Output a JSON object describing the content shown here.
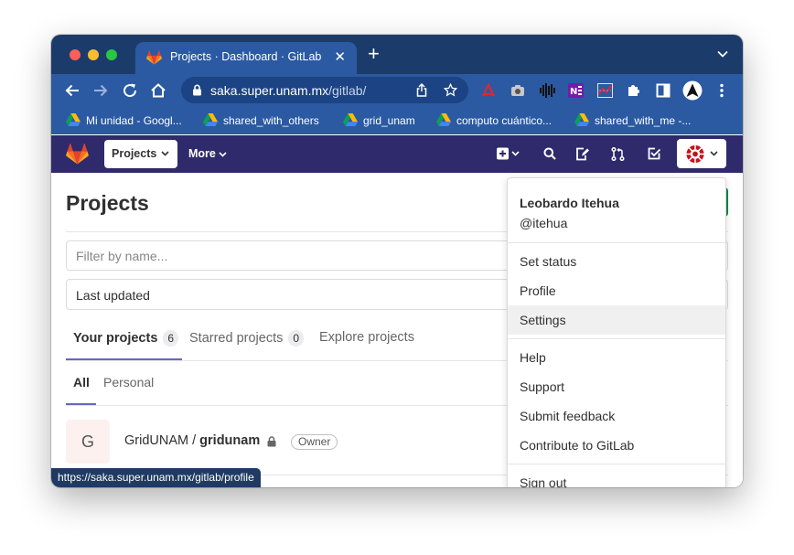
{
  "browser": {
    "tab_title": "Projects · Dashboard · GitLab",
    "url_host": "saka.super.unam.mx",
    "url_path": "/gitlab/",
    "status_url": "https://saka.super.unam.mx/gitlab/profile"
  },
  "bookmarks": [
    {
      "label": "Mi unidad - Googl..."
    },
    {
      "label": "shared_with_others"
    },
    {
      "label": "grid_unam"
    },
    {
      "label": "computo cuántico..."
    },
    {
      "label": "shared_with_me -..."
    }
  ],
  "header": {
    "projects_label": "Projects",
    "more_label": "More"
  },
  "page": {
    "title": "Projects",
    "filter_placeholder": "Filter by name...",
    "sort_value": "Last updated",
    "tabs": [
      {
        "label": "Your projects",
        "count": "6"
      },
      {
        "label": "Starred projects",
        "count": "0"
      },
      {
        "label": "Explore projects"
      }
    ],
    "subtabs": [
      {
        "label": "All"
      },
      {
        "label": "Personal"
      }
    ],
    "projects": [
      {
        "initial": "G",
        "namespace": "GridUNAM / ",
        "name": "gridunam",
        "role": "Owner"
      }
    ]
  },
  "user_menu": {
    "name": "Leobardo Itehua",
    "handle": "@itehua",
    "items_group1": [
      "Set status",
      "Profile",
      "Settings"
    ],
    "items_group2": [
      "Help",
      "Support",
      "Submit feedback",
      "Contribute to GitLab"
    ],
    "signout": "Sign out"
  },
  "colors": {
    "tab_strip": "#1b3c6b",
    "toolbar": "#2b5aa2",
    "gitlab_header": "#2f2a6b",
    "gitlab_orange": "#e24329",
    "active_tab_underline": "#6666c4"
  }
}
